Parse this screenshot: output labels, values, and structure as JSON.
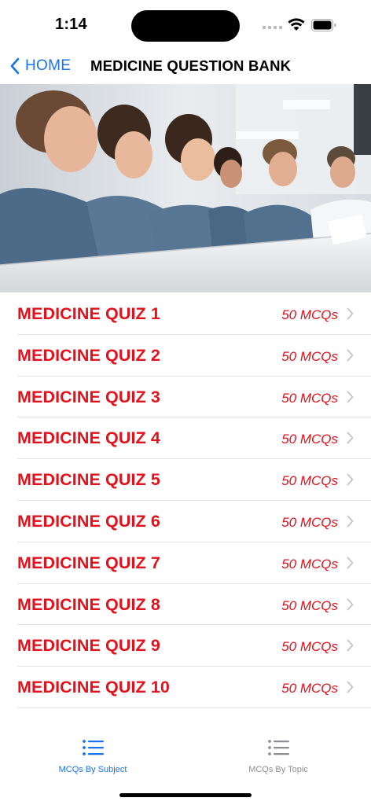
{
  "status_bar": {
    "time": "1:14"
  },
  "nav": {
    "back_label": "HOME",
    "title": "MEDICINE QUESTION BANK"
  },
  "hero": {
    "icon": "classroom-photo"
  },
  "quizzes": [
    {
      "title": "MEDICINE QUIZ 1",
      "count": "50 MCQs"
    },
    {
      "title": "MEDICINE QUIZ 2",
      "count": "50 MCQs"
    },
    {
      "title": "MEDICINE QUIZ 3",
      "count": "50 MCQs"
    },
    {
      "title": "MEDICINE QUIZ 4",
      "count": "50 MCQs"
    },
    {
      "title": "MEDICINE QUIZ 5",
      "count": "50 MCQs"
    },
    {
      "title": "MEDICINE QUIZ 6",
      "count": "50 MCQs"
    },
    {
      "title": "MEDICINE QUIZ 7",
      "count": "50 MCQs"
    },
    {
      "title": "MEDICINE QUIZ 8",
      "count": "50 MCQs"
    },
    {
      "title": "MEDICINE QUIZ 9",
      "count": "50 MCQs"
    },
    {
      "title": "MEDICINE QUIZ 10",
      "count": "50 MCQs"
    }
  ],
  "tabs": [
    {
      "label": "MCQs By Subject",
      "icon": "list-bullet-icon",
      "active": true
    },
    {
      "label": "MCQs By Topic",
      "icon": "list-bullet-icon",
      "active": false
    }
  ],
  "colors": {
    "accent": "#1a73e8",
    "quiz_red": "#e2111b",
    "inactive": "#8e8e93"
  }
}
